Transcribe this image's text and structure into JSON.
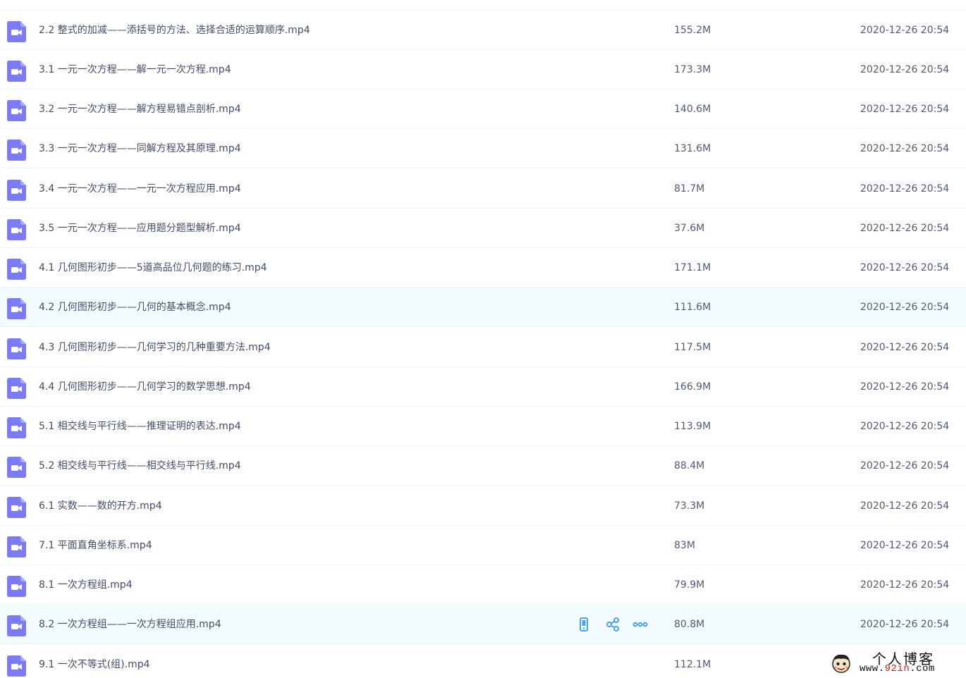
{
  "colors": {
    "file_icon": "#7b7cf5",
    "row_hover_bg": "#f4fbff",
    "action_icon": "#4aa3ef",
    "text": "#424e67"
  },
  "file_icon_name": "video-file-icon",
  "files": [
    {
      "name": "2.2 整式的加减——添括号的方法、选择合适的运算顺序.mp4",
      "size": "155.2M",
      "date": "2020-12-26 20:54"
    },
    {
      "name": "3.1 一元一次方程——解一元一次方程.mp4",
      "size": "173.3M",
      "date": "2020-12-26 20:54"
    },
    {
      "name": "3.2 一元一次方程——解方程易错点剖析.mp4",
      "size": "140.6M",
      "date": "2020-12-26 20:54"
    },
    {
      "name": "3.3 一元一次方程——同解方程及其原理.mp4",
      "size": "131.6M",
      "date": "2020-12-26 20:54"
    },
    {
      "name": "3.4 一元一次方程——一元一次方程应用.mp4",
      "size": "81.7M",
      "date": "2020-12-26 20:54"
    },
    {
      "name": "3.5 一元一次方程——应用题分题型解析.mp4",
      "size": "37.6M",
      "date": "2020-12-26 20:54"
    },
    {
      "name": "4.1 几何图形初步——5道高品位几何题的练习.mp4",
      "size": "171.1M",
      "date": "2020-12-26 20:54"
    },
    {
      "name": "4.2 几何图形初步——几何的基本概念.mp4",
      "size": "111.6M",
      "date": "2020-12-26 20:54",
      "highlight": true
    },
    {
      "name": "4.3 几何图形初步——几何学习的几种重要方法.mp4",
      "size": "117.5M",
      "date": "2020-12-26 20:54"
    },
    {
      "name": "4.4 几何图形初步——几何学习的数学思想.mp4",
      "size": "166.9M",
      "date": "2020-12-26 20:54"
    },
    {
      "name": "5.1 相交线与平行线——推理证明的表达.mp4",
      "size": "113.9M",
      "date": "2020-12-26 20:54"
    },
    {
      "name": "5.2 相交线与平行线——相交线与平行线.mp4",
      "size": "88.4M",
      "date": "2020-12-26 20:54"
    },
    {
      "name": "6.1 实数——数的开方.mp4",
      "size": "73.3M",
      "date": "2020-12-26 20:54"
    },
    {
      "name": "7.1 平面直角坐标系.mp4",
      "size": "83M",
      "date": "2020-12-26 20:54"
    },
    {
      "name": "8.1 一次方程组.mp4",
      "size": "79.9M",
      "date": "2020-12-26 20:54"
    },
    {
      "name": "8.2 一次方程组——一次方程组应用.mp4",
      "size": "80.8M",
      "date": "2020-12-26 20:54",
      "highlight": true,
      "actions": [
        "phone-icon",
        "share-icon",
        "more-icon"
      ]
    },
    {
      "name": "9.1 一次不等式(组).mp4",
      "size": "112.1M",
      "date": ""
    }
  ],
  "watermark": {
    "title": "个人博客",
    "url_prefix": "www.",
    "url_highlight": "92in",
    "url_suffix": ".com"
  }
}
